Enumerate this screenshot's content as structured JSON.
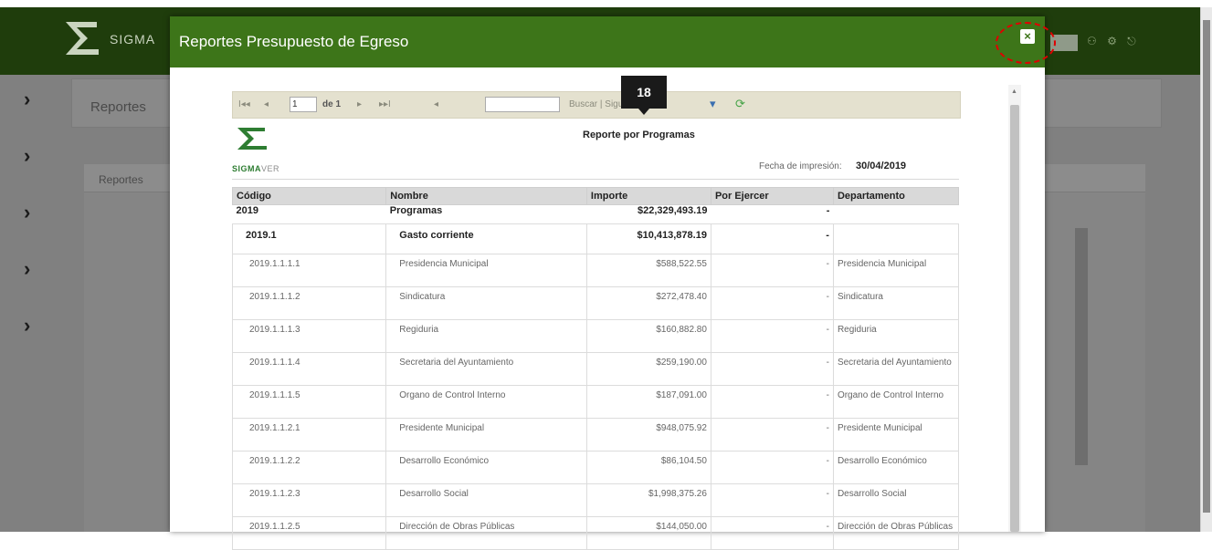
{
  "app": {
    "name": "SIGMA",
    "breadcrumb": "Reportes",
    "panel_title": "Reportes"
  },
  "modal": {
    "title": "Reportes Presupuesto de Egreso",
    "close_label": "×"
  },
  "toolbar": {
    "first": "I◂◂",
    "prev": "◂",
    "page_value": "1",
    "of_label": "de 1",
    "next": "▸",
    "last": "▸▸I",
    "back": "◂",
    "search_label": "Buscar | Siguiente",
    "export_icon": "save-export-icon",
    "refresh_icon": "refresh-icon"
  },
  "step_badge": "18",
  "report": {
    "logo_text_primary": "SIGMA",
    "logo_text_secondary": "VER",
    "title": "Reporte por Programas",
    "date_label": "Fecha de impresión:",
    "date_value": "30/04/2019",
    "columns": [
      "Código",
      "Nombre",
      "Importe",
      "Por Ejercer",
      "Departamento"
    ],
    "rows": [
      {
        "level": "top",
        "code": "2019",
        "name": "Programas",
        "amount": "$22,329,493.19",
        "dash": "-",
        "dept": ""
      },
      {
        "level": "sub",
        "code": "2019.1",
        "name": "Gasto corriente",
        "amount": "$10,413,878.19",
        "dash": "-",
        "dept": ""
      },
      {
        "level": "item",
        "code": "2019.1.1.1.1",
        "name": "Presidencia Municipal",
        "amount": "$588,522.55",
        "dash": "-",
        "dept": "Presidencia Municipal"
      },
      {
        "level": "item",
        "code": "2019.1.1.1.2",
        "name": "Sindicatura",
        "amount": "$272,478.40",
        "dash": "-",
        "dept": "Sindicatura"
      },
      {
        "level": "item",
        "code": "2019.1.1.1.3",
        "name": "Regiduria",
        "amount": "$160,882.80",
        "dash": "-",
        "dept": "Regiduria"
      },
      {
        "level": "item",
        "code": "2019.1.1.1.4",
        "name": "Secretaria del Ayuntamiento",
        "amount": "$259,190.00",
        "dash": "-",
        "dept": "Secretaria del Ayuntamiento"
      },
      {
        "level": "item",
        "code": "2019.1.1.1.5",
        "name": "Organo de Control Interno",
        "amount": "$187,091.00",
        "dash": "-",
        "dept": "Organo de Control Interno"
      },
      {
        "level": "item",
        "code": "2019.1.1.2.1",
        "name": "Presidente Municipal",
        "amount": "$948,075.92",
        "dash": "-",
        "dept": "Presidente Municipal"
      },
      {
        "level": "item",
        "code": "2019.1.1.2.2",
        "name": "Desarrollo Económico",
        "amount": "$86,104.50",
        "dash": "-",
        "dept": "Desarrollo Económico"
      },
      {
        "level": "item",
        "code": "2019.1.1.2.3",
        "name": "Desarrollo Social",
        "amount": "$1,998,375.26",
        "dash": "-",
        "dept": "Desarrollo Social"
      },
      {
        "level": "item",
        "code": "2019.1.1.2.5",
        "name": "Dirección de Obras Públicas",
        "amount": "$144,050.00",
        "dash": "-",
        "dept": "Dirección de Obras Públicas"
      }
    ]
  },
  "colors": {
    "header_dark": "#1f3d0c",
    "modal_header": "#3d7519",
    "highlight_ring": "#e00000"
  }
}
